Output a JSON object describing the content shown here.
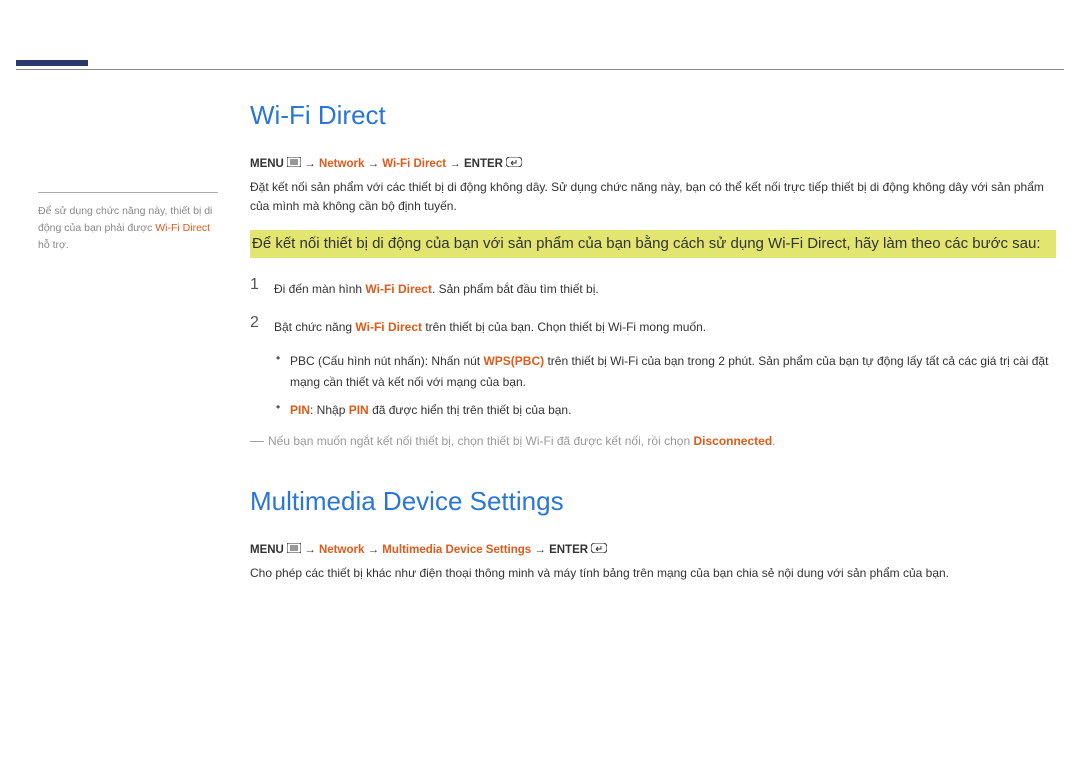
{
  "sidebar": {
    "note_prefix": "Để sử dụng chức năng này, thiết bị di động của bạn phải được ",
    "note_highlight": "Wi-Fi Direct",
    "note_suffix": " hỗ trợ."
  },
  "section1": {
    "title": "Wi-Fi Direct",
    "path": {
      "menu": "MENU",
      "arrow": "→",
      "network": "Network",
      "wifidirect": "Wi-Fi Direct",
      "enter": "ENTER"
    },
    "desc": "Đặt kết nối sản phẩm với các thiết bị di động không dây. Sử dụng chức năng này, bạn có thể kết nối trực tiếp thiết bị di động không dây với sản phẩm của mình mà không cần bộ định tuyến.",
    "highlight": "Để kết nối thiết bị di động của bạn với sản phẩm của bạn bằng cách sử dụng Wi-Fi Direct, hãy làm theo các bước sau:",
    "steps": [
      {
        "num": "1",
        "prefix": "Đi đến màn hình ",
        "highlight": "Wi-Fi Direct",
        "suffix": ". Sản phẩm bắt đầu tìm thiết bị."
      },
      {
        "num": "2",
        "prefix": "Bật chức năng ",
        "highlight": "Wi-Fi Direct",
        "suffix": " trên thiết bị của bạn. Chọn thiết bị Wi-Fi mong muốn."
      }
    ],
    "bullets": [
      {
        "prefix": "PBC (Cấu hình nút nhấn): Nhấn nút ",
        "highlight": "WPS(PBC)",
        "suffix": " trên thiết bị Wi-Fi của bạn trong 2 phút. Sản phẩm của bạn tự động lấy tất cả các giá trị cài đặt mạng cần thiết và kết nối với mạng của bạn."
      },
      {
        "prefix1": "",
        "highlight1": "PIN",
        "middle": ": Nhập ",
        "highlight2": "PIN",
        "suffix": " đã được hiển thị trên thiết bị của bạn."
      }
    ],
    "note": {
      "prefix": "Nếu bạn muốn ngắt kết nối thiết bị, chọn thiết bị Wi-Fi đã được kết nối, rồi chọn ",
      "highlight": "Disconnected",
      "suffix": "."
    }
  },
  "section2": {
    "title": "Multimedia Device Settings",
    "path": {
      "menu": "MENU",
      "arrow": "→",
      "network": "Network",
      "mds": "Multimedia Device Settings",
      "enter": "ENTER"
    },
    "desc": "Cho phép các thiết bị khác như điện thoại thông minh và máy tính bảng trên mạng của bạn chia sẻ nội dung với sản phẩm của bạn."
  }
}
